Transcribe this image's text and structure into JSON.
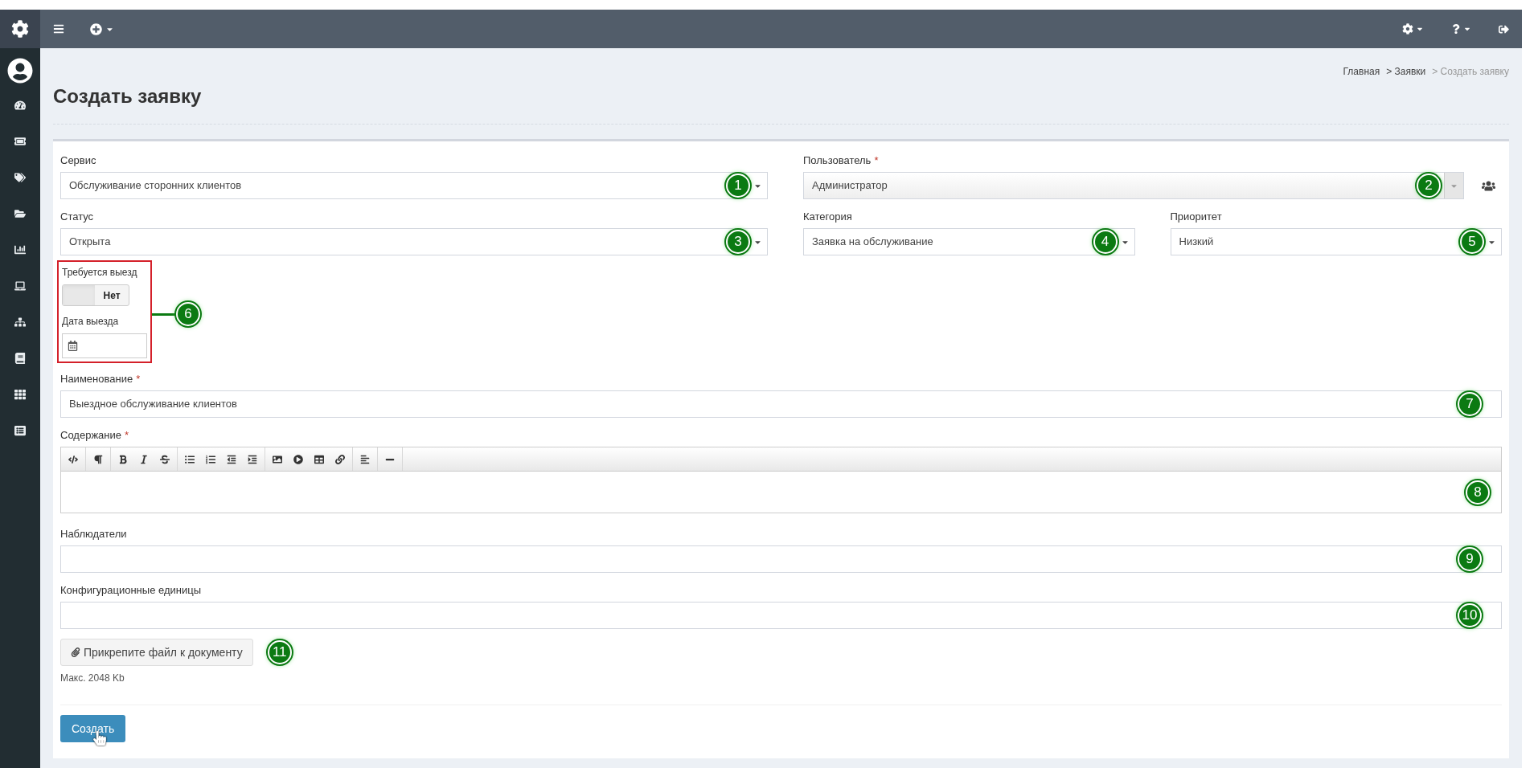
{
  "breadcrumb": [
    {
      "label": "Главная",
      "current": false
    },
    {
      "label": "> Заявки",
      "current": false
    },
    {
      "label": "> Создать заявку",
      "current": true
    }
  ],
  "page_title": "Создать заявку",
  "form": {
    "service": {
      "label": "Сервис",
      "value": "Обслуживание сторонних клиентов",
      "marker": "1"
    },
    "user": {
      "label": "Пользователь",
      "required_mark": "*",
      "value": "Администратор",
      "marker": "2"
    },
    "status": {
      "label": "Статус",
      "value": "Открыта",
      "marker": "3"
    },
    "category": {
      "label": "Категория",
      "value": "Заявка на обслуживание",
      "marker": "4"
    },
    "priority": {
      "label": "Приоритет",
      "value": "Низкий",
      "marker": "5"
    },
    "trip": {
      "label": "Требуется выезд",
      "toggle": {
        "on": false,
        "text": "Нет"
      },
      "date_label": "Дата выезда",
      "marker": "6"
    },
    "name": {
      "label": "Наименование",
      "required_mark": "*",
      "value": "Выездное обслуживание клиентов",
      "marker": "7"
    },
    "content": {
      "label": "Содержание",
      "required_mark": "*",
      "marker": "8"
    },
    "watchers": {
      "label": "Наблюдатели",
      "marker": "9"
    },
    "config_items": {
      "label": "Конфигурационные единицы",
      "marker": "10"
    },
    "attach": {
      "label": "Прикрепите файл к документу",
      "note": "Макс. 2048 Kb",
      "marker": "11"
    },
    "submit": "Создать"
  }
}
